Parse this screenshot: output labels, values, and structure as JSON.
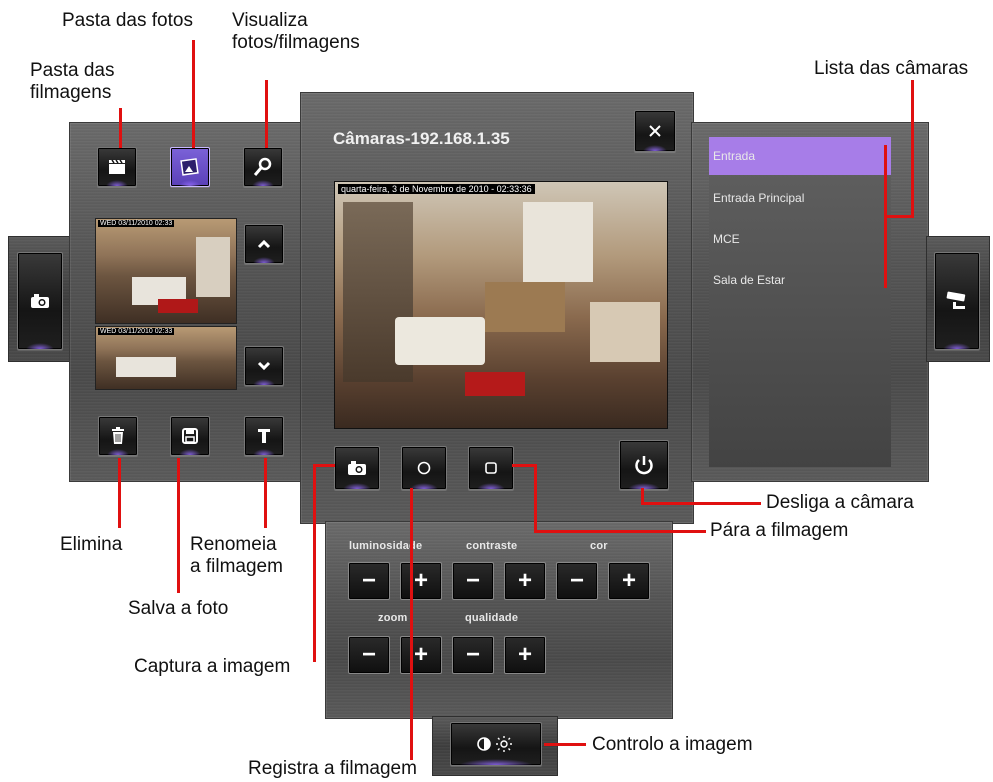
{
  "window": {
    "title": "Câmaras-192.168.1.35"
  },
  "video": {
    "timestamp": "quarta-feira, 3 de Novembro de 2010 - 02:33:36"
  },
  "cameras": [
    {
      "label": "Entrada",
      "selected": true
    },
    {
      "label": "Entrada Principal",
      "selected": false
    },
    {
      "label": "MCE",
      "selected": false
    },
    {
      "label": "Sala de Estar",
      "selected": false
    }
  ],
  "thumbs": {
    "overlay_text": "WED 03/11/2010 02:33"
  },
  "controls": {
    "brightness": "luminosidade",
    "contrast": "contraste",
    "color": "cor",
    "zoom": "zoom",
    "quality": "qualidade",
    "minus": "−",
    "plus": "+"
  },
  "annotations": {
    "pasta_fotos": "Pasta das fotos",
    "visualiza": "Visualiza\nfotos/filmagens",
    "pasta_filmagens": "Pasta das\nfilmagens",
    "lista_camaras": "Lista das câmaras",
    "desliga": "Desliga a câmara",
    "para": "Pára a filmagem",
    "elimina": "Elimina",
    "renomeia": "Renomeia\na filmagem",
    "salva": "Salva a foto",
    "captura": "Captura a imagem",
    "controlo": "Controlo a imagem",
    "registra": "Registra a filmagem"
  },
  "icons": {
    "accent": "#a77de8",
    "callout_line": "#e01010"
  }
}
